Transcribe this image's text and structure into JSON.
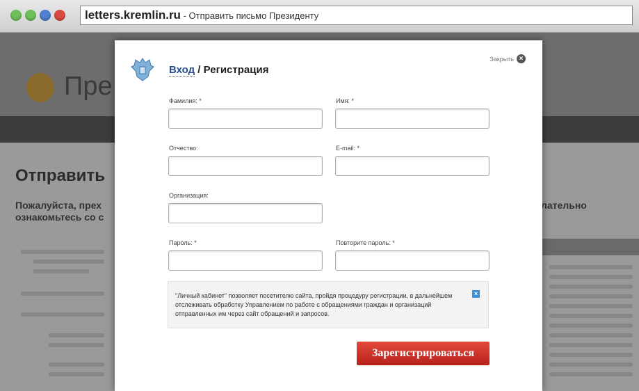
{
  "browser": {
    "host": "letters.kremlin.ru",
    "title_sep": " - ",
    "title": "Отправить письмо Президенту"
  },
  "background_page": {
    "brand": "Пре",
    "heading": "Отправить",
    "subtext_line1": "Пожалуйста, прех",
    "subtext_line2": "ознакомьтесь со с",
    "subtext_right": "лательно"
  },
  "modal": {
    "tab_login": "Вход",
    "separator": " / ",
    "tab_register": "Регистрация",
    "close_label": "Закрыть",
    "fields": {
      "lastname_label": "Фамилия: *",
      "firstname_label": "Имя: *",
      "patronymic_label": "Отчество:",
      "email_label": "E-mail: *",
      "organization_label": "Организация:",
      "password_label": "Пароль: *",
      "password_repeat_label": "Повторите пароль: *"
    },
    "info_text": "\"Личный кабинет\" позволяет посетителю сайта, пройдя процедуру регистрации, в дальнейшем отслеживать обработку Управлением по работе с обращениями граждан и организаций отправленных им через сайт обращений и запросов.",
    "submit_label": "Зарегистрироваться"
  },
  "colors": {
    "submit": "#c9281e",
    "link": "#2a4d8f",
    "info_icon": "#3b8fd6"
  }
}
